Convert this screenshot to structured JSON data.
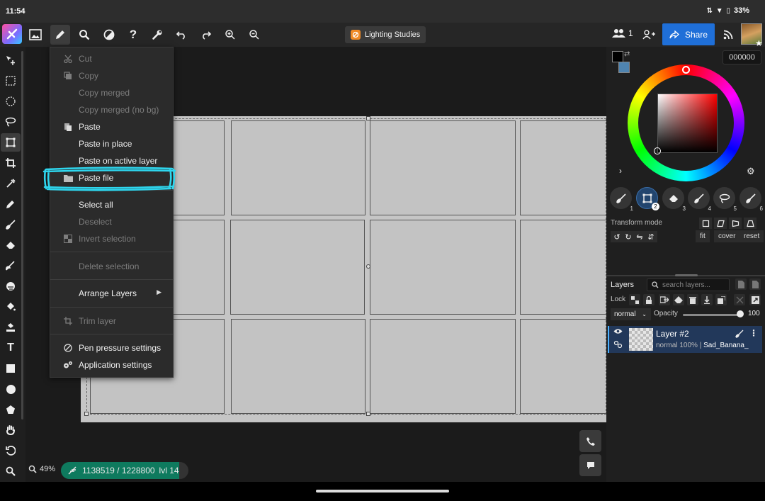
{
  "status_bar": {
    "time": "11:54",
    "battery": "33%"
  },
  "topbar": {
    "doc_title": "Lighting Studies",
    "users_count": "1",
    "share_label": "Share"
  },
  "menu": {
    "items": [
      {
        "label": "Cut",
        "enabled": false
      },
      {
        "label": "Copy",
        "enabled": false
      },
      {
        "label": "Copy merged",
        "enabled": false
      },
      {
        "label": "Copy merged (no bg)",
        "enabled": false
      },
      {
        "label": "Paste",
        "enabled": true
      },
      {
        "label": "Paste in place",
        "enabled": true
      },
      {
        "label": "Paste on active layer",
        "enabled": true
      },
      {
        "label": "Paste file",
        "enabled": true
      },
      {
        "label": "Select all",
        "enabled": true
      },
      {
        "label": "Deselect",
        "enabled": false
      },
      {
        "label": "Invert selection",
        "enabled": false
      },
      {
        "label": "Delete selection",
        "enabled": false
      },
      {
        "label": "Arrange Layers",
        "enabled": true
      },
      {
        "label": "Trim layer",
        "enabled": false
      },
      {
        "label": "Pen pressure settings",
        "enabled": true
      },
      {
        "label": "Application settings",
        "enabled": true
      }
    ]
  },
  "canvas": {
    "zoom": "49%",
    "progress_text": "1138519 / 1228800",
    "progress_fraction": 0.9265,
    "level": "lvl 14"
  },
  "color": {
    "hex_value": "000000",
    "foreground": "#000000",
    "background": "#4f84b0"
  },
  "brushes": {
    "slots": [
      "1",
      "2",
      "3",
      "4",
      "5",
      "6"
    ],
    "active_slot": "2"
  },
  "transform": {
    "label": "Transform mode",
    "fit": "fit",
    "cover": "cover",
    "reset": "reset"
  },
  "layers": {
    "title": "Layers",
    "search_placeholder": "search layers...",
    "lock_label": "Lock",
    "blend_mode": "normal",
    "opacity_label": "Opacity",
    "opacity_value": "100",
    "active_layer": {
      "name": "Layer #2",
      "mode": "normal",
      "opacity": "100%",
      "owner": "Sad_Banana_"
    }
  }
}
